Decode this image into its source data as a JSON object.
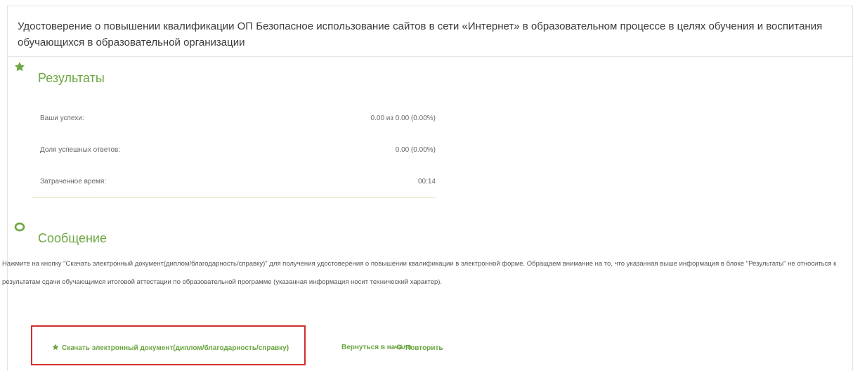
{
  "header": {
    "title": "Удостоверение о повышении квалификации ОП Безопасное использование сайтов в сети «Интернет» в образовательном процессе в целях обучения и воспитания обучающихся в образовательной организации"
  },
  "results": {
    "title": "Результаты",
    "icon": "star-icon",
    "rows": [
      {
        "label": "Ваши успехи:",
        "value": "0.00 из 0.00 (0.00%)"
      },
      {
        "label": "Доля успешных ответов:",
        "value": "0.00 (0.00%)"
      },
      {
        "label": "Затраченное время:",
        "value": "00:14"
      }
    ]
  },
  "message": {
    "title": "Сообщение",
    "icon": "ring-icon",
    "text": "Нажмите на кнопку \"Скачать электронный документ(диплом/благодарность/справку)\" для получения удостоверения о повышении квалификации в электронной форме. Обращаем внимание на то, что указанная выше информация в блоке \"Результаты\" не относиться к результатам сдачи обучающимся итоговой аттестации по образовательной программе (указанная информация носит технический характер)."
  },
  "actions": {
    "download_label": "Скачать электронный документ(диплом/благодарность/справку)",
    "back_label": "Вернуться в начало",
    "repeat_label": "Повторить"
  },
  "colors": {
    "accent_green": "#6fa842",
    "highlight_red": "#d32f2f"
  }
}
